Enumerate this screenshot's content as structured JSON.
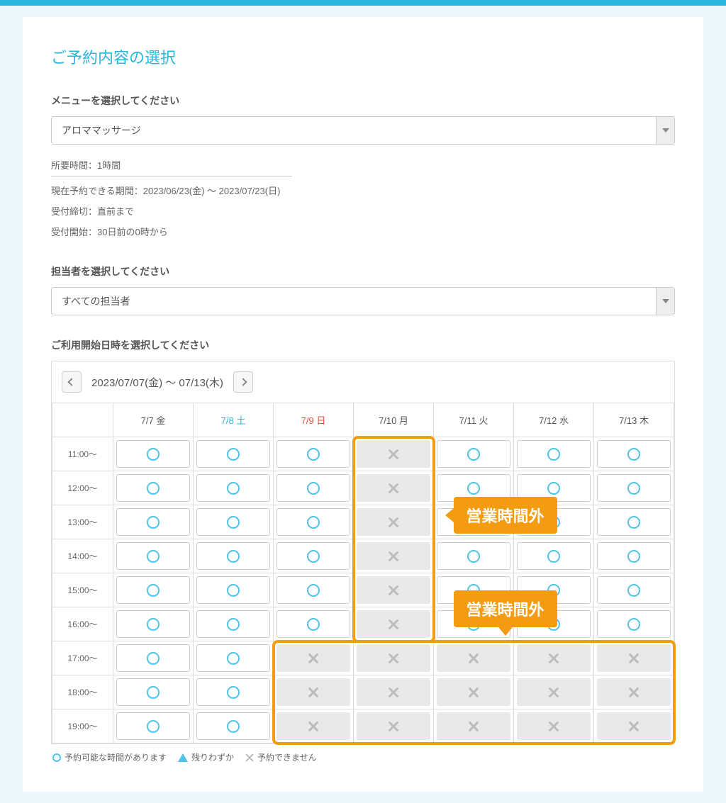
{
  "header": {
    "title": "ご予約内容の選択"
  },
  "menu_section": {
    "label": "メニューを選択してください",
    "selected": "アロママッサージ",
    "meta": {
      "duration": "所要時間：1時間",
      "period": "現在予約できる期間：2023/06/23(金) 〜 2023/07/23(日)",
      "deadline": "受付締切：直前まで",
      "start": "受付開始：30日前の0時から"
    }
  },
  "staff_section": {
    "label": "担当者を選択してください",
    "selected": "すべての担当者"
  },
  "datetime_section": {
    "label": "ご利用開始日時を選択してください",
    "range_label": "2023/07/07(金) 〜 07/13(木)",
    "days": [
      {
        "label": "7/7 金",
        "type": "weekday"
      },
      {
        "label": "7/8 土",
        "type": "sat"
      },
      {
        "label": "7/9 日",
        "type": "sun"
      },
      {
        "label": "7/10 月",
        "type": "weekday"
      },
      {
        "label": "7/11 火",
        "type": "weekday"
      },
      {
        "label": "7/12 水",
        "type": "weekday"
      },
      {
        "label": "7/13 木",
        "type": "weekday"
      }
    ],
    "times": [
      "11:00〜",
      "12:00〜",
      "13:00〜",
      "14:00〜",
      "15:00〜",
      "16:00〜",
      "17:00〜",
      "18:00〜",
      "19:00〜"
    ],
    "slots": [
      [
        "open",
        "open",
        "open",
        "closed",
        "open",
        "open",
        "open"
      ],
      [
        "open",
        "open",
        "open",
        "closed",
        "open",
        "open",
        "open"
      ],
      [
        "open",
        "open",
        "open",
        "closed",
        "open",
        "open",
        "open"
      ],
      [
        "open",
        "open",
        "open",
        "closed",
        "open",
        "open",
        "open"
      ],
      [
        "open",
        "open",
        "open",
        "closed",
        "open",
        "open",
        "open"
      ],
      [
        "open",
        "open",
        "open",
        "closed",
        "open",
        "open",
        "open"
      ],
      [
        "open",
        "open",
        "closed",
        "closed",
        "closed",
        "closed",
        "closed"
      ],
      [
        "open",
        "open",
        "closed",
        "closed",
        "closed",
        "closed",
        "closed"
      ],
      [
        "open",
        "open",
        "closed",
        "closed",
        "closed",
        "closed",
        "closed"
      ]
    ]
  },
  "callouts": {
    "c1": "営業時間外",
    "c2": "営業時間外"
  },
  "legend": {
    "available": "予約可能な時間があります",
    "few": "残りわずか",
    "unavailable": "予約できません"
  }
}
